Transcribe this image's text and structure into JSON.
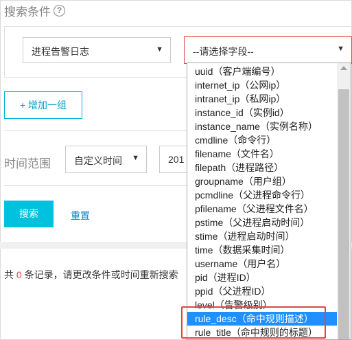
{
  "search_conditions": {
    "title": "搜索条件",
    "help_icon": "?"
  },
  "log_type_select": {
    "value": "进程告警日志",
    "caret": "▼"
  },
  "field_select": {
    "value": "--请选择字段--",
    "caret": "▼"
  },
  "add_group": {
    "label": "+ 增加一组"
  },
  "time_range": {
    "label": "时间范围",
    "range_select": {
      "value": "自定义时间",
      "caret": "▼"
    },
    "date_value": "201"
  },
  "actions": {
    "search_label": "搜索",
    "reset_label": "重置"
  },
  "result": {
    "prefix": "共 ",
    "count": "0",
    "suffix": " 条记录，请更改条件或时间重新搜索"
  },
  "field_options": [
    "uuid（客户端编号）",
    "internet_ip（公网ip）",
    "intranet_ip（私网ip）",
    "instance_id（实例id）",
    "instance_name（实例名称）",
    "cmdline（命令行）",
    "filename（文件名）",
    "filepath（进程路径）",
    "groupname（用户组）",
    "pcmdline（父进程命令行）",
    "pfilename（父进程文件名）",
    "pstime（父进程启动时间）",
    "stime（进程启动时间）",
    "time（数据采集时间）",
    "username（用户名）",
    "pid（进程ID）",
    "ppid（父进程ID）",
    "level（告警级别）",
    "rule_desc（命中规则描述）",
    "rule_title（命中规则的标题）"
  ],
  "selected_option_index": 18,
  "colors": {
    "accent": "#00c1de",
    "highlight": "#e0454a",
    "selected": "#1e90ff"
  }
}
